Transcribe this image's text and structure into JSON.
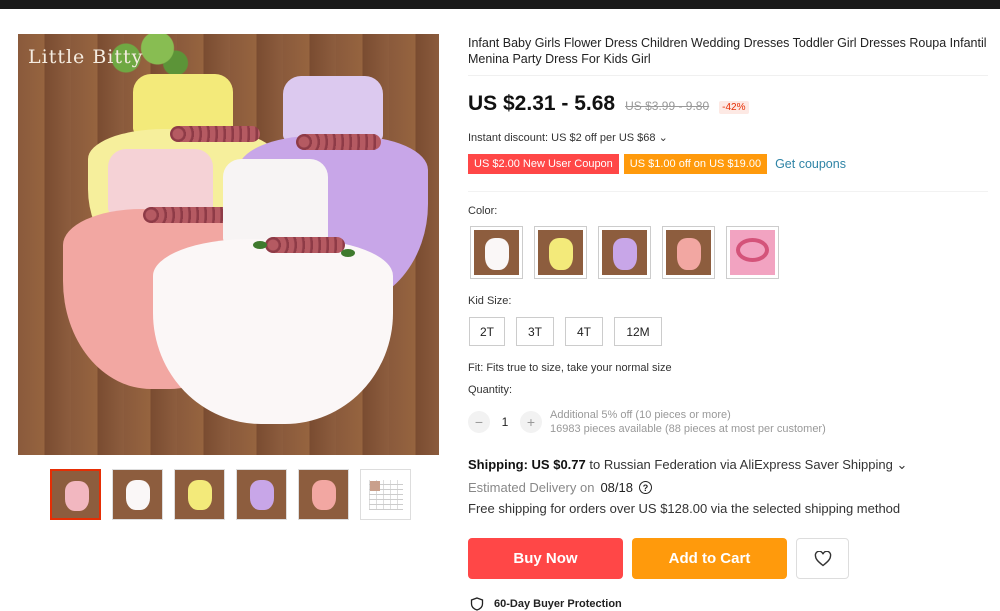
{
  "product": {
    "title": "Infant Baby Girls Flower Dress Children Wedding Dresses Toddler Girl Dresses Roupa Infantil Menina Party Dress For Kids Girl",
    "price": "US $2.31 - 5.68",
    "old_price": "US $3.99 - 9.80",
    "discount": "-42%",
    "instant_discount": "Instant discount: US $2 off per US $68 ⌄"
  },
  "gallery": {
    "brand_watermark": "Little Bitty",
    "thumbnails": [
      {
        "name": "thumb-group",
        "active": true
      },
      {
        "name": "thumb-white",
        "active": false
      },
      {
        "name": "thumb-yellow",
        "active": false
      },
      {
        "name": "thumb-purple",
        "active": false
      },
      {
        "name": "thumb-pink",
        "active": false
      },
      {
        "name": "thumb-size-chart",
        "active": false
      }
    ]
  },
  "coupons": {
    "new_user": "US $2.00 New User Coupon",
    "store": "US $1.00 off on US $19.00",
    "get_coupons": "Get coupons"
  },
  "color": {
    "label": "Color:",
    "options": [
      "white",
      "yellow",
      "purple",
      "pink",
      "headband"
    ]
  },
  "size": {
    "label": "Kid Size:",
    "options": [
      "2T",
      "3T",
      "4T",
      "12M"
    ]
  },
  "fit": "Fit: Fits true to size, take your normal size",
  "quantity": {
    "label": "Quantity:",
    "value": "1",
    "minus": "−",
    "plus": "+",
    "additional": "Additional 5% off (10 pieces or more)",
    "available": "16983 pieces available (88 pieces at most per customer)"
  },
  "shipping": {
    "label": "Shipping: US $0.77",
    "destination": " to Russian Federation via AliExpress Saver Shipping ⌄",
    "estimated_label": "Estimated Delivery on",
    "estimated_date": "08/18",
    "free": "Free shipping for orders over US $128.00 via the selected shipping method"
  },
  "actions": {
    "buy_now": "Buy Now",
    "add_to_cart": "Add to Cart"
  },
  "protection": "60-Day Buyer Protection",
  "colors": {
    "accent_red": "#ff4747",
    "accent_orange": "#ff9a0c",
    "link_blue": "#2f84a6"
  }
}
